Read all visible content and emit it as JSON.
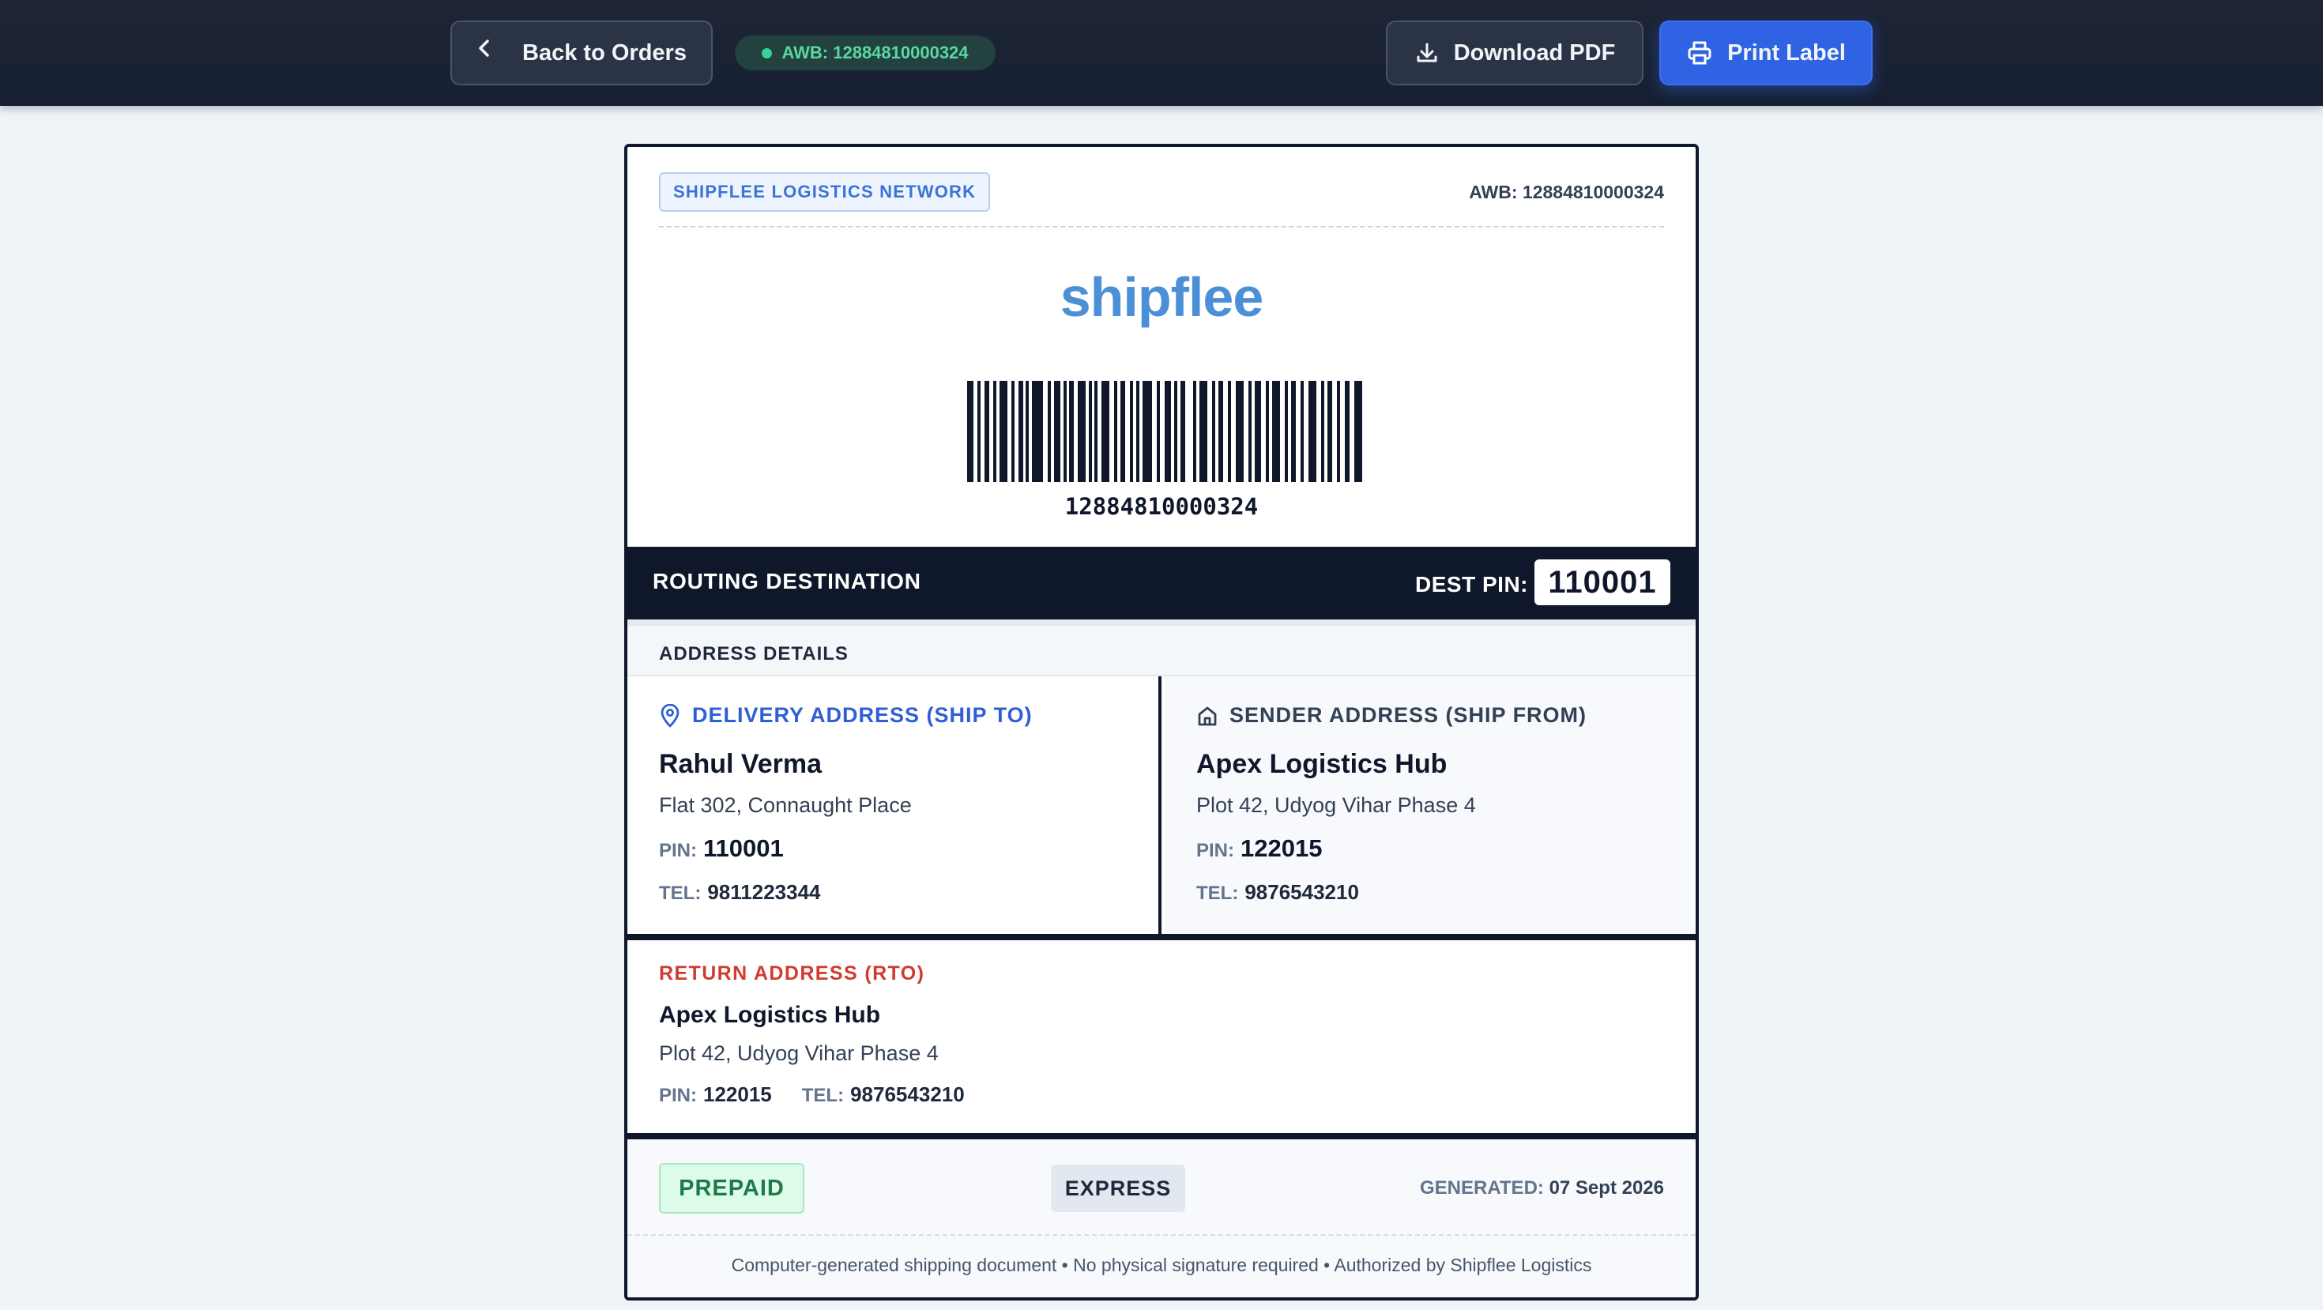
{
  "topbar": {
    "back_label": "Back to Orders",
    "awb_pill": "AWB: 12884810000324",
    "download_label": "Download PDF",
    "print_label": "Print Label"
  },
  "label": {
    "network_badge": "SHIPFLEE LOGISTICS NETWORK",
    "awb_top": "AWB: 12884810000324",
    "logo_text": "shipflee",
    "barcode_number": "12884810000324",
    "routing_title": "ROUTING DESTINATION",
    "dest_pin_label": "DEST PIN:",
    "dest_pin": "110001",
    "address_details_title": "ADDRESS DETAILS",
    "delivery": {
      "title": "DELIVERY ADDRESS (SHIP TO)",
      "name": "Rahul Verma",
      "line1": "Flat 302, Connaught Place",
      "pin_label": "PIN:",
      "pin": "110001",
      "tel_label": "TEL:",
      "tel": "9811223344"
    },
    "sender": {
      "title": "SENDER ADDRESS (SHIP FROM)",
      "name": "Apex Logistics Hub",
      "line1": "Plot 42, Udyog Vihar Phase 4",
      "pin_label": "PIN:",
      "pin": "122015",
      "tel_label": "TEL:",
      "tel": "9876543210"
    },
    "rto": {
      "title": "RETURN ADDRESS (RTO)",
      "name": "Apex Logistics Hub",
      "line1": "Plot 42, Udyog Vihar Phase 4",
      "pin_label": "PIN:",
      "pin": "122015",
      "tel_label": "TEL:",
      "tel": "9876543210"
    },
    "payment_badge": "PREPAID",
    "service_badge": "EXPRESS",
    "generated_label": "GENERATED:",
    "generated_date": "07 Sept 2026",
    "fine_print": "Computer-generated shipping document • No physical signature required • Authorized by Shipflee Logistics"
  },
  "colors": {
    "topbar_bg": "#1d2536",
    "primary_button": "#2f63e3",
    "awb_pill_text": "#5ad7a2",
    "ship_to_accent": "#2f5fd6",
    "rto_accent": "#d23a2f",
    "logo": "#4b90d6",
    "prepaid_bg": "#dcfbe8"
  },
  "icons": {
    "back": "chevron-left-icon",
    "awb_status": "status-dot-icon",
    "download": "download-icon",
    "print": "printer-icon",
    "delivery": "map-pin-icon",
    "sender": "home-icon"
  }
}
